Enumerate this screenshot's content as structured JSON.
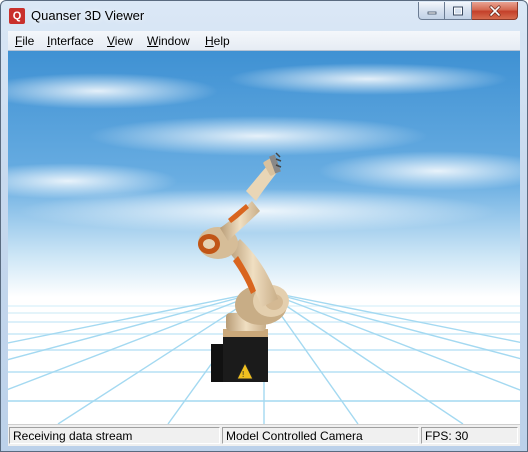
{
  "window": {
    "title": "Quanser 3D Viewer",
    "icon": "quanser-logo-icon",
    "app_icon_text": "Q",
    "controls": [
      "minimize-icon",
      "maximize-icon",
      "close-icon"
    ]
  },
  "menu": {
    "items": [
      {
        "label": "File"
      },
      {
        "label": "Interface"
      },
      {
        "label": "View"
      },
      {
        "label": "Window"
      },
      {
        "label": "Help"
      }
    ]
  },
  "viewport": {
    "scene": "robot-arm-3d-model",
    "sky_color": "#4a98d6",
    "floor_grid_color": "#9ad6f0",
    "robot_body_color": "#e6d2b2",
    "robot_accent_color": "#d9651f",
    "base_color": "#1b1b1b",
    "warning_label_color": "#f0c020"
  },
  "status": {
    "left": "Receiving data stream",
    "middle": "Model Controlled Camera",
    "right": "FPS: 30"
  }
}
